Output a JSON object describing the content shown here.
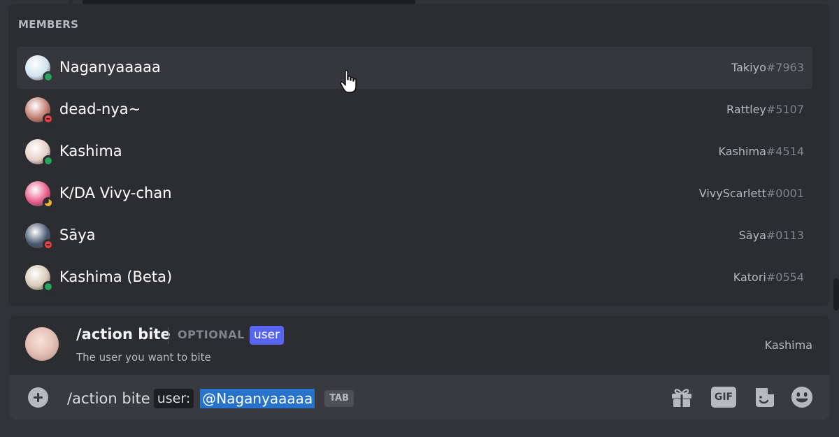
{
  "popup": {
    "header": "MEMBERS",
    "members": [
      {
        "name": "Naganyaaaaa",
        "username": "Takiyo",
        "discriminator": "#7963",
        "status": "online",
        "avatar_color": "#cfe3ef",
        "selected": true
      },
      {
        "name": "dead-nya~",
        "username": "Rattley",
        "discriminator": "#5107",
        "status": "dnd",
        "avatar_color": "#c27d6f",
        "selected": false
      },
      {
        "name": "Kashima",
        "username": "Kashima",
        "discriminator": "#4514",
        "status": "online",
        "avatar_color": "#e8cfc6",
        "selected": false
      },
      {
        "name": "K/DA Vivy-chan",
        "username": "VivyScarlett",
        "discriminator": "#0001",
        "status": "idle",
        "avatar_color": "#e85d8a",
        "selected": false
      },
      {
        "name": "Sāya",
        "username": "Sāya",
        "discriminator": "#0113",
        "status": "dnd",
        "avatar_color": "#4a5a72",
        "selected": false
      },
      {
        "name": "Kashima (Beta)",
        "username": "Katori",
        "discriminator": "#0554",
        "status": "online",
        "avatar_color": "#d8c9b4",
        "selected": false
      }
    ]
  },
  "option": {
    "command": "/action bite",
    "optional_label": "OPTIONAL",
    "param_name": "user",
    "description": "The user you want to bite",
    "bot_name": "Kashima"
  },
  "input": {
    "command_text": "/action bite",
    "param_chip": "user:",
    "mention": "@Naganyaaaaa",
    "tab_hint": "TAB",
    "gif_label": "GIF"
  },
  "icons": {
    "add": "plus-circle-icon",
    "gift": "gift-icon",
    "gif": "gif-icon",
    "sticker": "sticker-icon",
    "emoji": "emoji-icon",
    "cursor": "hand-pointer-icon"
  },
  "colors": {
    "background": "#313338",
    "popup": "#2b2d31",
    "selected_row": "#35373c",
    "input_bar": "#383a40",
    "accent": "#5865f2",
    "mention_selection": "#2672cc",
    "online": "#23a55a",
    "dnd": "#f23f43",
    "idle": "#f0b232"
  }
}
